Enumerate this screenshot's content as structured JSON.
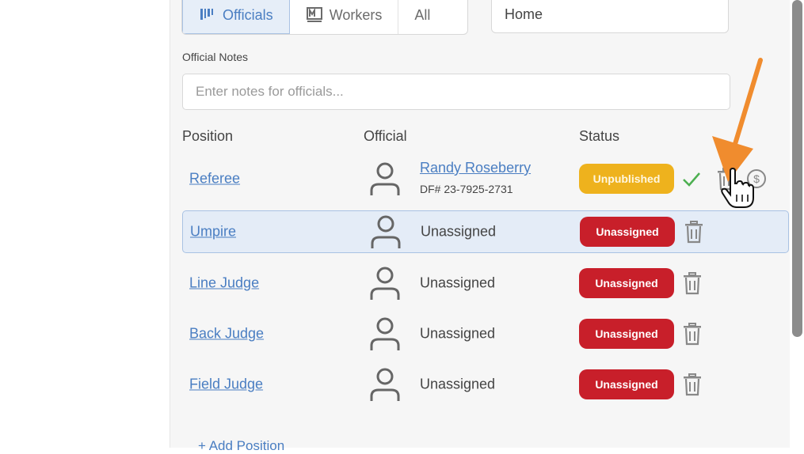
{
  "tabs": [
    {
      "label": "Officials",
      "icon": "officials-icon",
      "active": true
    },
    {
      "label": "Workers",
      "icon": "workers-icon",
      "active": false
    },
    {
      "label": "All",
      "icon": null,
      "active": false
    }
  ],
  "location_field": {
    "value": "Home"
  },
  "notes": {
    "label": "Official Notes",
    "placeholder": "Enter notes for officials..."
  },
  "table": {
    "headers": {
      "position": "Position",
      "official": "Official",
      "status": "Status"
    },
    "rows": [
      {
        "position": "Referee",
        "official": "Randy Roseberry",
        "official_id": "DF# 23-7925-2731",
        "status": "Unpublished",
        "status_color": "#eeb21d",
        "assigned": true
      },
      {
        "position": "Umpire",
        "official": "Unassigned",
        "status": "Unassigned",
        "status_color": "#c81f2a",
        "assigned": false,
        "selected": true
      },
      {
        "position": "Line Judge",
        "official": "Unassigned",
        "status": "Unassigned",
        "status_color": "#c81f2a",
        "assigned": false
      },
      {
        "position": "Back Judge",
        "official": "Unassigned",
        "status": "Unassigned",
        "status_color": "#c81f2a",
        "assigned": false
      },
      {
        "position": "Field Judge",
        "official": "Unassigned",
        "status": "Unassigned",
        "status_color": "#c81f2a",
        "assigned": false
      }
    ]
  },
  "add_position": {
    "label": "+ Add Position"
  },
  "colors": {
    "accent": "#4a7ec2",
    "annotation_arrow": "#f08c2e",
    "unassigned": "#c81f2a",
    "unpublished": "#eeb21d"
  }
}
